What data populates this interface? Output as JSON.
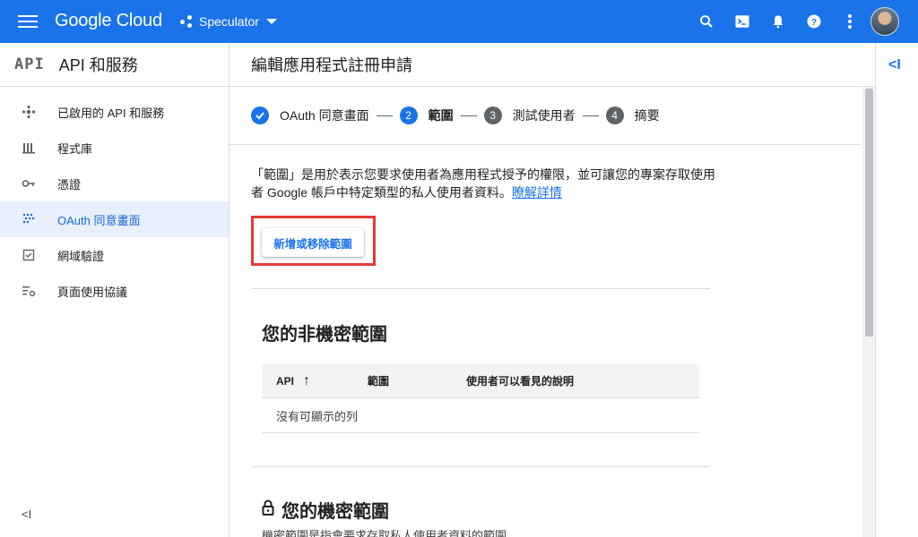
{
  "topbar": {
    "app_name": "Google Cloud",
    "project_name": "Speculator",
    "brand_color": "#1a73e8",
    "icons": [
      "menu-icon",
      "search-icon",
      "terminal-icon",
      "bell-icon",
      "help-icon",
      "more-vert-icon",
      "avatar"
    ]
  },
  "sidenav": {
    "logo_text": "API",
    "title": "API 和服務",
    "items": [
      {
        "label": "已啟用的 API 和服務",
        "icon": "apis-diamond-icon",
        "active": false
      },
      {
        "label": "程式庫",
        "icon": "library-icon",
        "active": false
      },
      {
        "label": "憑證",
        "icon": "key-icon",
        "active": false
      },
      {
        "label": "OAuth 同意畫面",
        "icon": "dots-grid-icon",
        "active": true
      },
      {
        "label": "網域驗證",
        "icon": "checkbox-icon",
        "active": false
      },
      {
        "label": "頁面使用協議",
        "icon": "settings-list-icon",
        "active": false
      }
    ],
    "collapse_label": "<I"
  },
  "main": {
    "page_title": "編輯應用程式註冊申請",
    "stepper": [
      {
        "number": "✓",
        "label": "OAuth 同意畫面",
        "state": "done"
      },
      {
        "number": "2",
        "label": "範圍",
        "state": "current"
      },
      {
        "number": "3",
        "label": "測試使用者",
        "state": "pending"
      },
      {
        "number": "4",
        "label": "摘要",
        "state": "pending"
      }
    ],
    "description": "「範圍」是用於表示您要求使用者為應用程式授予的權限，並可讓您的專案存取使用者 Google 帳戶中特定類型的私人使用者資料。",
    "learn_more": "瞭解詳情",
    "add_remove_button": "新增或移除範圍",
    "non_sensitive_title": "您的非機密範圍",
    "table": {
      "headers": [
        "API",
        "範圍",
        "使用者可以看見的說明"
      ],
      "sort_arrow": "↑",
      "empty_text": "沒有可顯示的列"
    },
    "sensitive_title": "您的機密範圍",
    "sensitive_desc": "機密範圍是指會要求存取私人使用者資料的範圍。"
  },
  "rightrail": {
    "collapse_label": "<I"
  }
}
